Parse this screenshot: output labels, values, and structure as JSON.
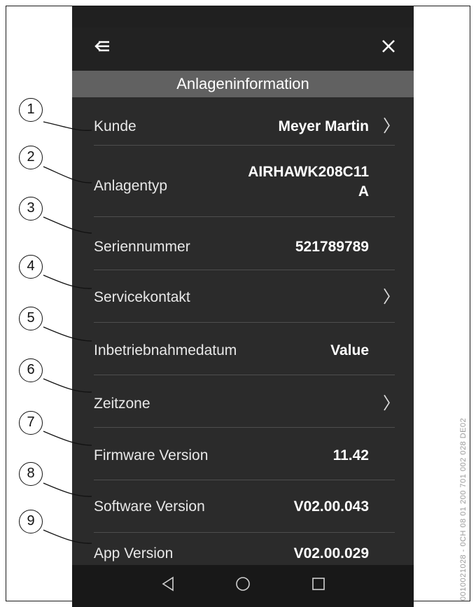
{
  "header": {
    "title": "Anlageninformation"
  },
  "rows": [
    {
      "label": "Kunde",
      "value": "Meyer Martin",
      "has_chevron": true
    },
    {
      "label": "Anlagentyp",
      "value_line1": "AIRHAWK208C11",
      "value_line2": "A",
      "has_chevron": false
    },
    {
      "label": "Seriennummer",
      "value": "521789789",
      "has_chevron": false
    },
    {
      "label": "Servicekontakt",
      "value": "",
      "has_chevron": true
    },
    {
      "label": "Inbetriebnahmedatum",
      "value": "Value",
      "has_chevron": false
    },
    {
      "label": "Zeitzone",
      "value": "",
      "has_chevron": true
    },
    {
      "label": "Firmware Version",
      "value": "11.42",
      "has_chevron": false
    },
    {
      "label": "Software Version",
      "value": "V02.00.043",
      "has_chevron": false
    },
    {
      "label": "App Version",
      "value": "V02.00.029",
      "has_chevron": false
    }
  ],
  "callouts": [
    "1",
    "2",
    "3",
    "4",
    "5",
    "6",
    "7",
    "8",
    "9"
  ],
  "side_code": "0010021028 - 0CH 08 01 200 701 002 028 DE02",
  "icons": {
    "back": "back-menu-icon",
    "close": "close-icon",
    "chevron": "chevron-right-icon",
    "nav_back": "triangle-back-icon",
    "nav_home": "circle-home-icon",
    "nav_recent": "square-recent-icon"
  },
  "colors": {
    "background": "#2b2b2b",
    "title_bar": "#616161",
    "nav_bar": "#181818"
  }
}
